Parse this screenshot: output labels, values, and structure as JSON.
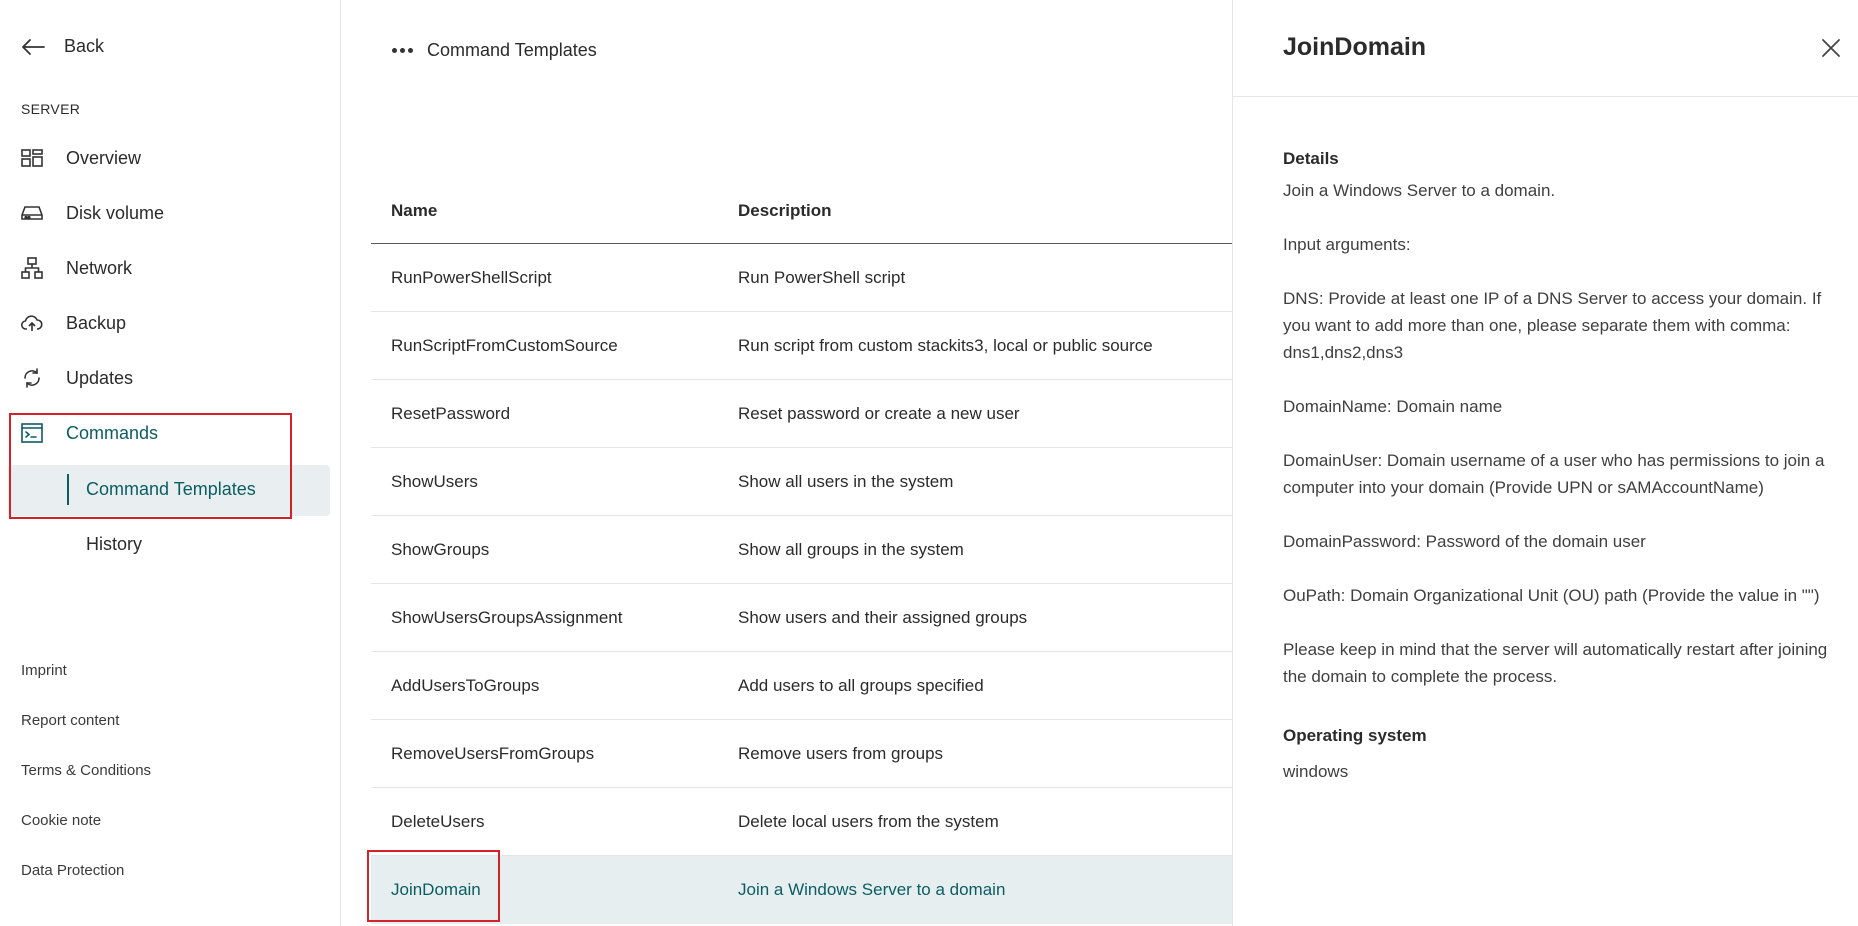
{
  "sidebar": {
    "back_label": "Back",
    "section_label": "SERVER",
    "nav": [
      {
        "label": "Overview",
        "icon": "dashboard-grid-icon"
      },
      {
        "label": "Disk volume",
        "icon": "disk-drive-icon"
      },
      {
        "label": "Network",
        "icon": "network-icon"
      },
      {
        "label": "Backup",
        "icon": "cloud-upload-icon"
      },
      {
        "label": "Updates",
        "icon": "refresh-icon"
      },
      {
        "label": "Commands",
        "icon": "terminal-icon"
      }
    ],
    "sub_items": [
      {
        "label": "Command Templates"
      },
      {
        "label": "History"
      }
    ],
    "footer_links": [
      {
        "label": "Imprint"
      },
      {
        "label": "Report content"
      },
      {
        "label": "Terms & Conditions"
      },
      {
        "label": "Cookie note"
      },
      {
        "label": "Data Protection"
      }
    ]
  },
  "main": {
    "breadcrumb": "Command Templates",
    "table": {
      "headers": {
        "name": "Name",
        "description": "Description"
      },
      "rows": [
        {
          "name": "RunPowerShellScript",
          "description": "Run PowerShell script"
        },
        {
          "name": "RunScriptFromCustomSource",
          "description": "Run script from custom stackits3, local or public source"
        },
        {
          "name": "ResetPassword",
          "description": "Reset password or create a new user"
        },
        {
          "name": "ShowUsers",
          "description": "Show all users in the system"
        },
        {
          "name": "ShowGroups",
          "description": "Show all groups in the system"
        },
        {
          "name": "ShowUsersGroupsAssignment",
          "description": "Show users and their assigned groups"
        },
        {
          "name": "AddUsersToGroups",
          "description": "Add users to all groups specified"
        },
        {
          "name": "RemoveUsersFromGroups",
          "description": "Remove users from groups"
        },
        {
          "name": "DeleteUsers",
          "description": "Delete local users from the system"
        },
        {
          "name": "JoinDomain",
          "description": "Join a Windows Server to a domain"
        }
      ]
    }
  },
  "panel": {
    "title": "JoinDomain",
    "details_heading": "Details",
    "details_text": "Join a Windows Server to a domain.\n\nInput arguments:\n\nDNS: Provide at least one IP of a DNS Server to access your domain. If you want to add more than one, please separate them with comma: dns1,dns2,dns3\n\nDomainName: Domain name\n\nDomainUser: Domain username of a user who has permissions to join a computer into your domain (Provide UPN or sAMAccountName)\n\nDomainPassword: Password of the domain user\n\nOuPath: Domain Organizational Unit (OU) path (Provide the value in \"\")\n\nPlease keep in mind that the server will automatically restart after joining the domain to complete the process.",
    "os_heading": "Operating system",
    "os_value": "windows"
  },
  "colors": {
    "accent": "#0b5d63",
    "highlight_box": "#d3222a",
    "selected_bg": "#e6eeef"
  }
}
